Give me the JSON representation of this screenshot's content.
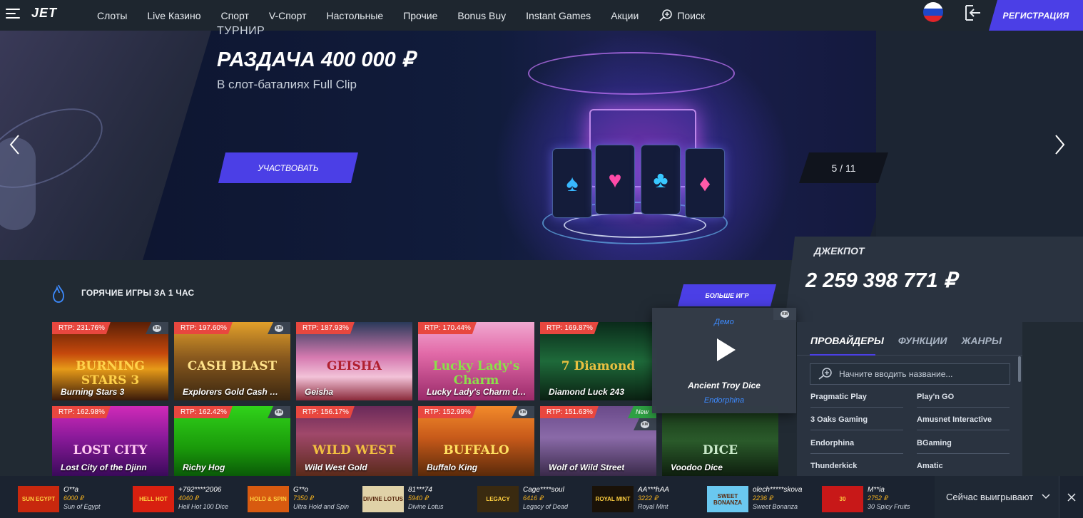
{
  "header": {
    "logo": "JET",
    "nav": [
      "Слоты",
      "Live Казино",
      "Спорт",
      "V-Спорт",
      "Настольные",
      "Прочие",
      "Bonus Buy",
      "Instant Games",
      "Акции"
    ],
    "search_label": "Поиск",
    "register_label": "РЕГИСТРАЦИЯ"
  },
  "banner": {
    "kicker": "ТУРНИР",
    "title": "РАЗДАЧА 400 000 ₽",
    "subtitle": "В слот-баталиях Full Clip",
    "button": "УЧАСТВОВАТЬ",
    "counter": "5 / 11"
  },
  "jackpot": {
    "label": "ДЖЕКПОТ",
    "value": "2 259 398 771 ₽"
  },
  "hot_games": {
    "title": "ГОРЯЧИЕ ИГРЫ ЗА 1 ЧАС",
    "more_button": "БОЛЬШЕ ИГР",
    "games": [
      {
        "rtp": "RTP: 231.76%",
        "name": "Burning Stars 3",
        "art": "BURNING STARS 3",
        "bg": "linear-gradient(180deg,#5a1f06 0%,#c5480c 40%,#e69a18 60%,#3a1a0a 100%)",
        "art_color": "#ffd24a",
        "km": "KM"
      },
      {
        "rtp": "RTP: 197.60%",
        "name": "Explorers Gold Cash …",
        "art": "CASH BLAST",
        "bg": "linear-gradient(180deg,#e2a02a 0%,#8a5a1e 45%,#3a2610 100%)",
        "art_color": "#ffe38a",
        "km": "KM"
      },
      {
        "rtp": "RTP: 187.93%",
        "name": "Geisha",
        "art": "GEISHA",
        "bg": "linear-gradient(180deg,#2a3a5a 0%,#d67ab0 45%,#f2c2d8 70%,#8a2a3a 100%)",
        "art_color": "#b02030",
        "km": ""
      },
      {
        "rtp": "RTP: 170.44%",
        "name": "Lucky Lady's Charm d…",
        "art": "Lucky Lady's Charm",
        "bg": "linear-gradient(180deg,#f0a8d0 0%,#e26aa8 40%,#9a2a6a 100%)",
        "art_color": "#8be04a",
        "km": ""
      },
      {
        "rtp": "RTP: 169.87%",
        "name": "Diamond Luck 243",
        "art": "7 Diamond",
        "bg": "linear-gradient(180deg,#0a2a1a 0%,#1e6a3a 50%,#0a2012 100%)",
        "art_color": "#e8c040",
        "km": ""
      },
      {
        "rtp": "RTP: 162.98%",
        "name": "Lost City of the Djinn",
        "art": "LOST CITY",
        "bg": "linear-gradient(180deg,#d02ab8 0%,#8a1a9a 45%,#3a0a5a 100%)",
        "art_color": "#ffc8f0",
        "km": ""
      },
      {
        "rtp": "RTP: 162.42%",
        "name": "Richy Hog",
        "art": "",
        "bg": "linear-gradient(180deg,#30d21a 0%,#1a9a0a 60%,#0a5a08 100%)",
        "art_color": "#ffd0d8",
        "km": "KM"
      },
      {
        "rtp": "RTP: 156.17%",
        "name": "Wild West Gold",
        "art": "WILD WEST",
        "bg": "linear-gradient(180deg,#6a2a5a 0%,#a0486a 40%,#5a2a1a 100%)",
        "art_color": "#f2c040",
        "km": ""
      },
      {
        "rtp": "RTP: 152.99%",
        "name": "Buffalo King",
        "art": "BUFFALO",
        "bg": "linear-gradient(180deg,#f28a2a 0%,#c85a1a 45%,#5a2a0a 100%)",
        "art_color": "#ffe060",
        "km": "KM"
      },
      {
        "rtp": "RTP: 151.63%",
        "name": "Wolf of Wild Street",
        "art": "",
        "bg": "linear-gradient(180deg,#6a4a8a 0%,#8a6aa8 45%,#3a2a4a 100%)",
        "art_color": "#ffffff",
        "km": "KM",
        "new": "New"
      },
      {
        "rtp": "",
        "name": "Voodoo Dice",
        "art": "DICE",
        "bg": "linear-gradient(180deg,#1a3a1a 0%,#2a5a2a 50%,#0e1e0e 100%)",
        "art_color": "#c8e8c8",
        "km": ""
      }
    ]
  },
  "demo_card": {
    "tag": "Демо",
    "name": "Ancient Troy Dice",
    "provider": "Endorphina"
  },
  "providers": {
    "tabs": [
      "ПРОВАЙДЕРЫ",
      "ФУНКЦИИ",
      "ЖАНРЫ"
    ],
    "search_placeholder": "Начните вводить название...",
    "list": [
      "Pragmatic Play",
      "Play'n GO",
      "3 Oaks Gaming",
      "Amusnet Interactive",
      "Endorphina",
      "BGaming",
      "Thunderkick",
      "Amatic"
    ]
  },
  "winners": {
    "label": "Сейчас выигрывают",
    "items": [
      {
        "user": "O**a",
        "amount": "6000 ₽",
        "game": "Sun of Egypt",
        "thumb": "SUN EGYPT",
        "bg": "#c8280e"
      },
      {
        "user": "+792****2006",
        "amount": "4040 ₽",
        "game": "Hell Hot 100 Dice",
        "thumb": "HELL HOT",
        "bg": "#d82010"
      },
      {
        "user": "G**o",
        "amount": "7350 ₽",
        "game": "Ultra Hold and Spin",
        "thumb": "HOLD & SPIN",
        "bg": "#d85a10"
      },
      {
        "user": "81***74",
        "amount": "5940 ₽",
        "game": "Divine Lotus",
        "thumb": "DIVINE LOTUS",
        "bg": "#e0d2a8"
      },
      {
        "user": "Cage****soul",
        "amount": "6416 ₽",
        "game": "Legacy of Dead",
        "thumb": "LEGACY",
        "bg": "#3a2a10"
      },
      {
        "user": "AA***hAA",
        "amount": "3222 ₽",
        "game": "Royal Mint",
        "thumb": "ROYAL MINT",
        "bg": "#1a1208"
      },
      {
        "user": "olech*****skova",
        "amount": "2236 ₽",
        "game": "Sweet Bonanza",
        "thumb": "SWEET BONANZA",
        "bg": "#6ac8f0"
      },
      {
        "user": "M**ia",
        "amount": "2752 ₽",
        "game": "30 Spicy Fruits",
        "thumb": "30",
        "bg": "#c81818"
      }
    ]
  }
}
